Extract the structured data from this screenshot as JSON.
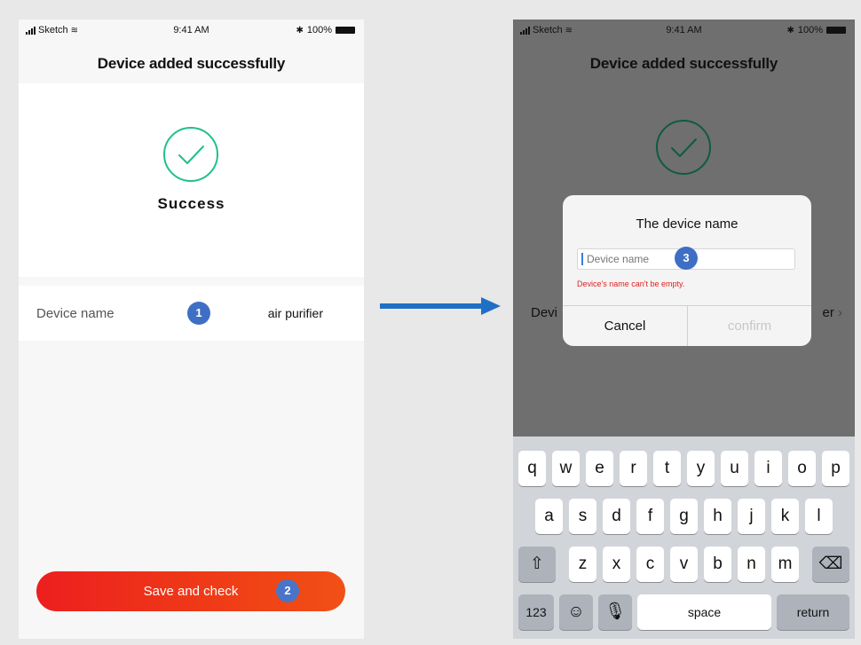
{
  "left_screen": {
    "status": {
      "carrier": "Sketch",
      "time": "9:41 AM",
      "battery": "100%"
    },
    "title": "Device added successfully",
    "success_text": "Success",
    "device_row": {
      "label": "Device name",
      "value": "air purifier"
    },
    "save_button": "Save and check",
    "badges": [
      "1",
      "2"
    ]
  },
  "right_screen": {
    "status": {
      "carrier": "Sketch",
      "time": "9:41 AM",
      "battery": "100%"
    },
    "title": "Device added successfully",
    "row_partial_left": "Devi",
    "row_partial_right": "er",
    "dialog": {
      "title": "The device name",
      "placeholder": "Device name",
      "error": "Device's name can't be empty.",
      "cancel": "Cancel",
      "confirm": "confirm"
    },
    "badge": "3",
    "keyboard": {
      "row1": [
        "q",
        "w",
        "e",
        "r",
        "t",
        "y",
        "u",
        "i",
        "o",
        "p"
      ],
      "row2": [
        "a",
        "s",
        "d",
        "f",
        "g",
        "h",
        "j",
        "k",
        "l"
      ],
      "row3": [
        "z",
        "x",
        "c",
        "v",
        "b",
        "n",
        "m"
      ],
      "numbers_key": "123",
      "space_key": "space",
      "return_key": "return"
    }
  },
  "colors": {
    "accent_green": "#1fbf8f",
    "button_red": "#ec1f1f",
    "badge_blue": "#3e6fc4",
    "arrow_blue": "#1f6fc4",
    "error_red": "#e02020"
  }
}
